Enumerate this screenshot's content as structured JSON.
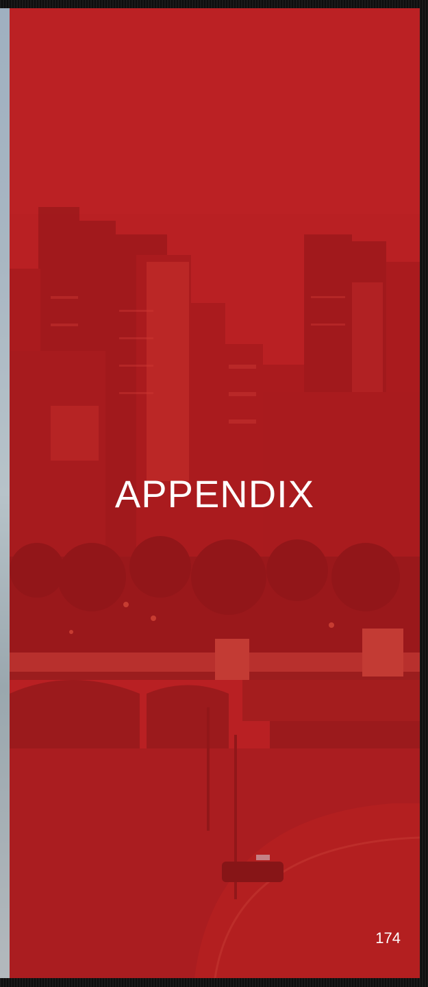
{
  "slide": {
    "title": "APPENDIX",
    "page_number": "174"
  },
  "theme": {
    "overlay_color": "#b81f22",
    "background_color": "#121212"
  },
  "image": {
    "description_icon": "city-skyline-with-bridge-photo"
  }
}
